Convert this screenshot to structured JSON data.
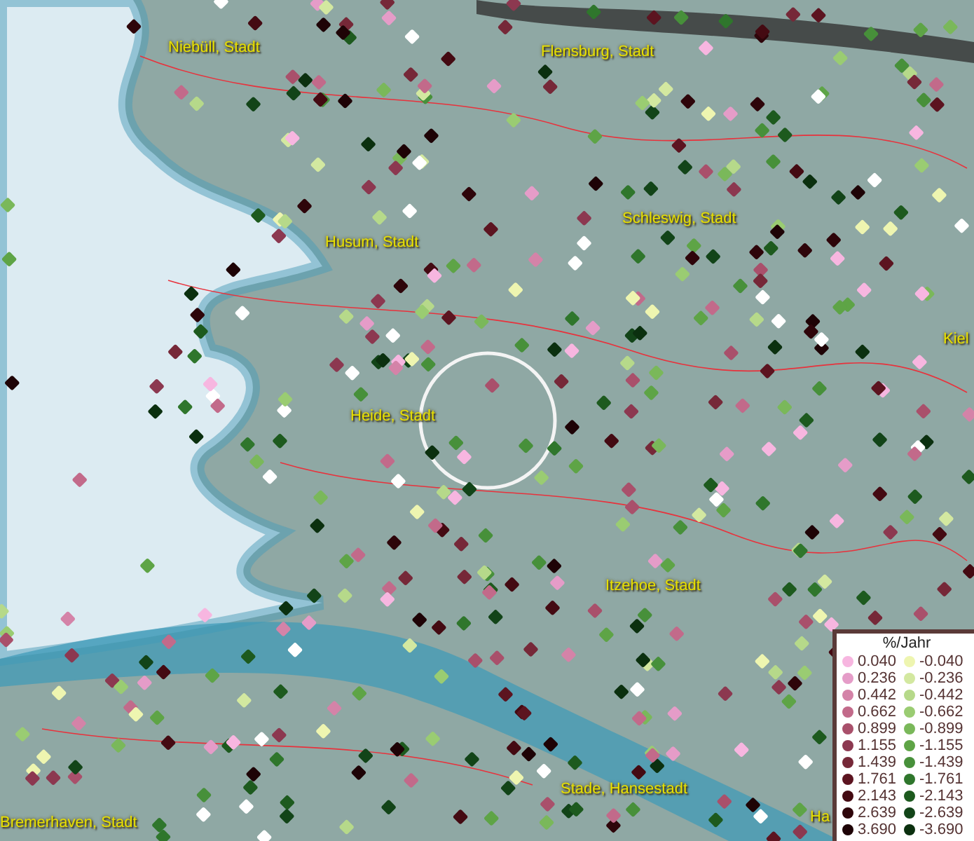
{
  "map": {
    "place_labels": [
      "Niebüll, Stadt",
      "Flensburg, Stadt",
      "Schleswig, Stadt",
      "Husum, Stadt",
      "Kiel",
      "Heide, Stadt",
      "Itzehoe, Stadt",
      "Stade, Hansestadt",
      "Bremerhaven, Stadt",
      "Ha"
    ]
  },
  "legend": {
    "title": "%/Jahr",
    "entries": [
      {
        "label": "0.040",
        "color": "#f7b6e0"
      },
      {
        "label": "-0.040",
        "color": "#eef5b0"
      },
      {
        "label": "0.236",
        "color": "#e59cc8"
      },
      {
        "label": "-0.236",
        "color": "#d3e8a0"
      },
      {
        "label": "0.442",
        "color": "#d483a8"
      },
      {
        "label": "-0.442",
        "color": "#b6d98a"
      },
      {
        "label": "0.662",
        "color": "#c26a8a"
      },
      {
        "label": "-0.662",
        "color": "#9acc72"
      },
      {
        "label": "0.899",
        "color": "#a9506b"
      },
      {
        "label": "-0.899",
        "color": "#7ab85a"
      },
      {
        "label": "1.155",
        "color": "#8c3850"
      },
      {
        "label": "-1.155",
        "color": "#5ea446"
      },
      {
        "label": "1.439",
        "color": "#762838"
      },
      {
        "label": "-1.439",
        "color": "#47903a"
      },
      {
        "label": "1.761",
        "color": "#5c1420"
      },
      {
        "label": "-1.761",
        "color": "#2f762c"
      },
      {
        "label": "2.143",
        "color": "#440a12"
      },
      {
        "label": "-2.143",
        "color": "#1d5a1e"
      },
      {
        "label": "2.639",
        "color": "#2e050a"
      },
      {
        "label": "-2.639",
        "color": "#124418"
      },
      {
        "label": "3.690",
        "color": "#1e0306"
      },
      {
        "label": "-3.690",
        "color": "#0b300f"
      }
    ]
  }
}
